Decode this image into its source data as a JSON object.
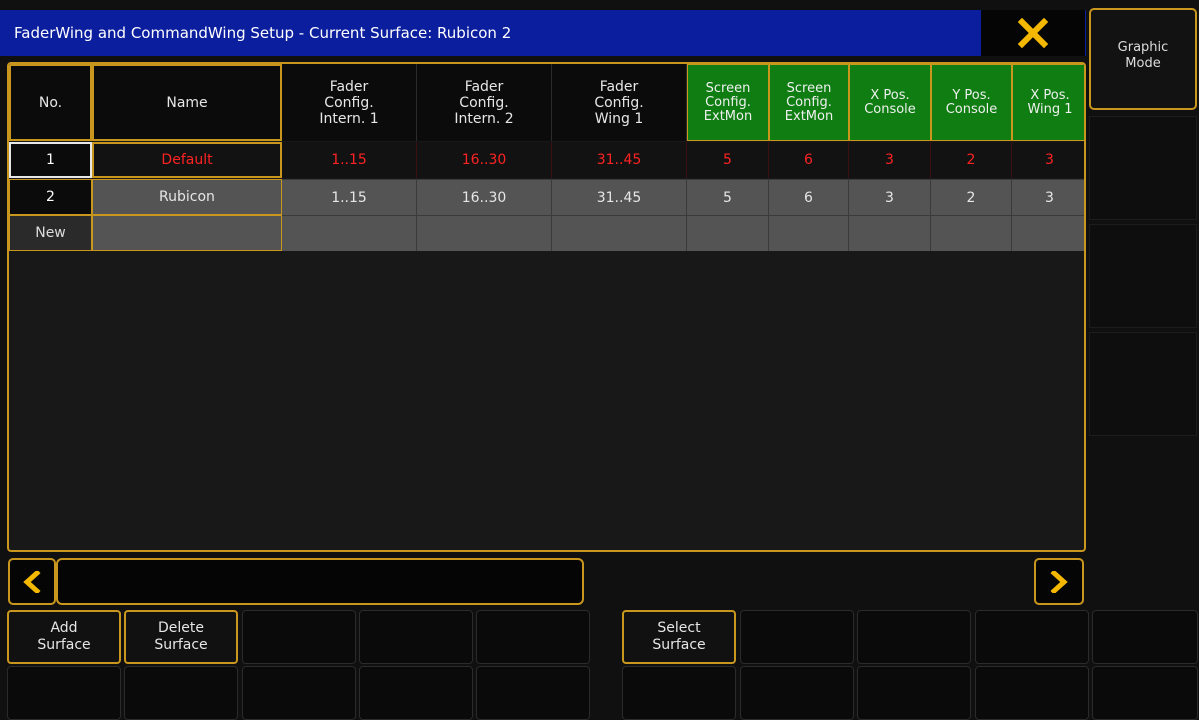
{
  "window": {
    "title": "FaderWing and CommandWing Setup - Current Surface: Rubicon 2",
    "close_icon": "close-x-icon",
    "accent_color": "#c9961e",
    "title_bar_color": "#0b1e9e"
  },
  "side": {
    "graphic_mode_label": "Graphic\nMode"
  },
  "table": {
    "headers": [
      "No.",
      "Name",
      "Fader\nConfig.\nIntern. 1",
      "Fader\nConfig.\nIntern. 2",
      "Fader\nConfig.\nWing 1",
      "Screen\nConfig.\nExtMon",
      "Screen\nConfig.\nExtMon",
      "X Pos.\nConsole",
      "Y Pos.\nConsole",
      "X Pos.\nWing 1"
    ],
    "rows": [
      [
        "1",
        "Default",
        "1..15",
        "16..30",
        "31..45",
        "5",
        "6",
        "3",
        "2",
        "3"
      ],
      [
        "2",
        "Rubicon",
        "1..15",
        "16..30",
        "31..45",
        "5",
        "6",
        "3",
        "2",
        "3"
      ],
      [
        "New",
        "",
        "",
        "",
        "",
        "",
        "",
        "",
        "",
        ""
      ]
    ]
  },
  "scroll": {
    "left_icon": "chevron-left-icon",
    "right_icon": "chevron-right-icon"
  },
  "buttons": {
    "row1": [
      "Add\nSurface",
      "Delete\nSurface",
      "",
      "",
      "",
      "Select\nSurface",
      "",
      "",
      "",
      ""
    ],
    "row2": [
      "",
      "",
      "",
      "",
      "",
      "",
      "",
      "",
      "",
      ""
    ]
  }
}
